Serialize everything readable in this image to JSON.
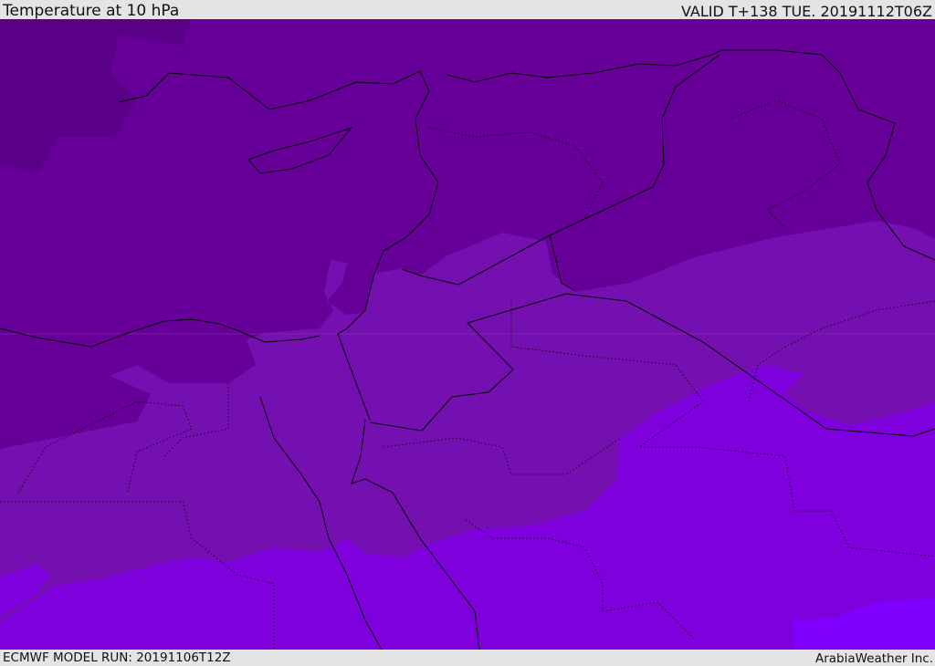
{
  "header": {
    "title": "Temperature at 10 hPa",
    "valid_time": "VALID T+138 TUE. 20191112T06Z"
  },
  "footer": {
    "model_run": "ECMWF MODEL RUN: 20191106T12Z",
    "credit": "ArabiaWeather Inc."
  },
  "colors": {
    "coldest": "#5b0088",
    "cold": "#660099",
    "mid": "#7510b0",
    "warm": "#7e00dc",
    "warmest": "#7f00ff",
    "border": "#000000",
    "frame": "#e4e4e4"
  }
}
